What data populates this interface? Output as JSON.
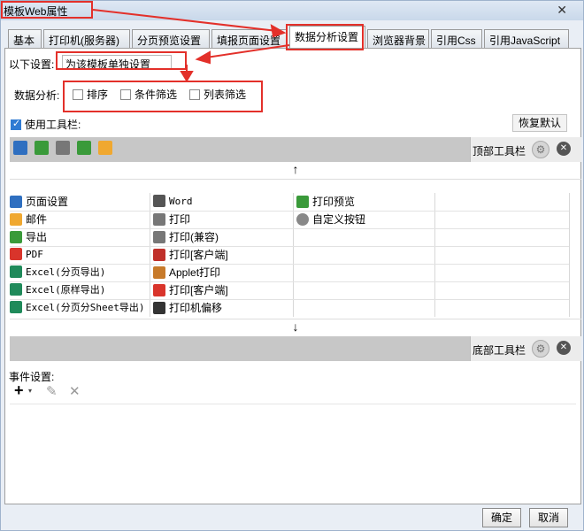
{
  "window": {
    "title": "模板Web属性",
    "close_symbol": "✕"
  },
  "tabs": [
    {
      "label": "基本"
    },
    {
      "label": "打印机(服务器)"
    },
    {
      "label": "分页预览设置"
    },
    {
      "label": "填报页面设置"
    },
    {
      "label": "数据分析设置"
    },
    {
      "label": "浏览器背景"
    },
    {
      "label": "引用Css"
    },
    {
      "label": "引用JavaScript"
    }
  ],
  "settings": {
    "label": "以下设置:",
    "select_value": "为该模板单独设置"
  },
  "analysis": {
    "label": "数据分析:",
    "options": [
      {
        "label": "排序",
        "checked": false
      },
      {
        "label": "条件筛选",
        "checked": false
      },
      {
        "label": "列表筛选",
        "checked": false
      }
    ]
  },
  "toolbar_section": {
    "use_toolbar_label": "使用工具栏:",
    "use_toolbar_checked": true,
    "restore_default": "恢复默认",
    "top_toolbar_label": "顶部工具栏",
    "bottom_toolbar_label": "底部工具栏",
    "move_up_symbol": "↑",
    "move_down_symbol": "↓"
  },
  "buttons_col1": [
    {
      "label": "页面设置",
      "icon": "page-setup-icon",
      "color": "#2f6fc0"
    },
    {
      "label": "邮件",
      "icon": "mail-icon",
      "color": "#f0a830"
    },
    {
      "label": "导出",
      "icon": "export-icon",
      "color": "#3a9a3a"
    },
    {
      "label": "PDF",
      "icon": "pdf-icon",
      "color": "#d9342b"
    },
    {
      "label": "Excel(分页导出)",
      "icon": "excel-icon",
      "color": "#1f8a5a"
    },
    {
      "label": "Excel(原样导出)",
      "icon": "excel-icon",
      "color": "#1f8a5a"
    },
    {
      "label": "Excel(分页分Sheet导出)",
      "icon": "excel-icon",
      "color": "#1f8a5a"
    }
  ],
  "buttons_col2": [
    {
      "label": "Word",
      "icon": "word-icon",
      "color": "#555555"
    },
    {
      "label": "打印",
      "icon": "print-icon",
      "color": "#777777"
    },
    {
      "label": "打印(兼容)",
      "icon": "print-icon",
      "color": "#777777"
    },
    {
      "label": "打印[客户端]",
      "icon": "flash-print-icon",
      "color": "#c0302a"
    },
    {
      "label": "Applet打印",
      "icon": "applet-icon",
      "color": "#c77a2a"
    },
    {
      "label": "打印[客户端]",
      "icon": "pdf-print-icon",
      "color": "#d9342b"
    },
    {
      "label": "打印机偏移",
      "icon": "move-icon",
      "color": "#333333"
    }
  ],
  "buttons_col3": [
    {
      "label": "打印预览",
      "icon": "print-preview-icon",
      "color": "#3a9a3a"
    },
    {
      "label": "自定义按钮",
      "icon": "custom-gear-icon",
      "color": "#888888"
    }
  ],
  "top_toolbar_icons": [
    {
      "icon": "page-setup-icon",
      "color": "#2f6fc0"
    },
    {
      "icon": "print-preview-icon",
      "color": "#3a9a3a"
    },
    {
      "icon": "print-icon",
      "color": "#777777"
    },
    {
      "icon": "export-icon",
      "color": "#3a9a3a"
    },
    {
      "icon": "mail-icon",
      "color": "#f0a830"
    }
  ],
  "events": {
    "label": "事件设置:",
    "add_symbol": "+",
    "edit_symbol": "✎",
    "delete_symbol": "✕"
  },
  "footer": {
    "ok": "确定",
    "cancel": "取消"
  },
  "colors": {
    "annotation": "#e3302a",
    "accent": "#2f7bd3"
  }
}
